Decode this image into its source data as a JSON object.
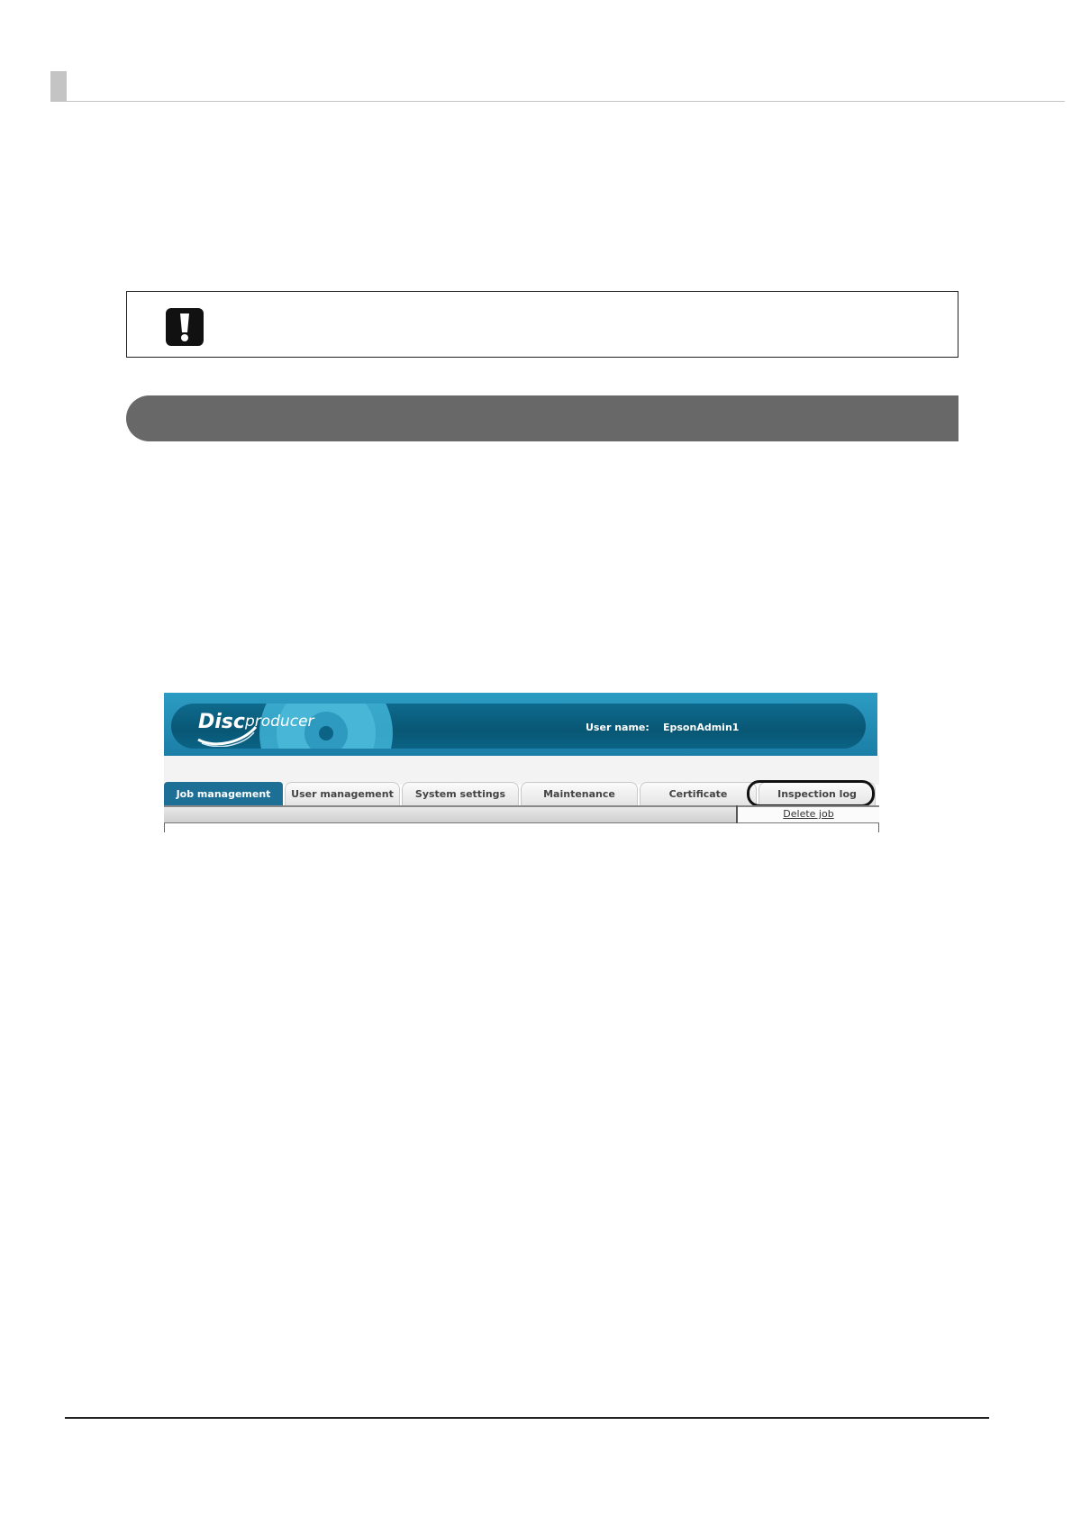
{
  "banner": {
    "logo_text": "Disc",
    "logo_subtext": "producer",
    "user_label": "User name:",
    "user_value": "EpsonAdmin1"
  },
  "tabs": [
    {
      "label": "Job management",
      "active": true
    },
    {
      "label": "User management",
      "active": false
    },
    {
      "label": "System settings",
      "active": false
    },
    {
      "label": "Maintenance",
      "active": false
    },
    {
      "label": "Certificate",
      "active": false
    },
    {
      "label": "Inspection log",
      "active": false,
      "highlighted": true
    }
  ],
  "subbar": {
    "delete_link": "Delete job"
  },
  "colors": {
    "banner_light": "#2c9cc3",
    "banner_dark": "#085774",
    "active_tab": "#1d6f95",
    "section_bar": "#686868",
    "header_marker": "#c4c4c4"
  },
  "icons": {
    "notice": "exclamation-icon"
  }
}
